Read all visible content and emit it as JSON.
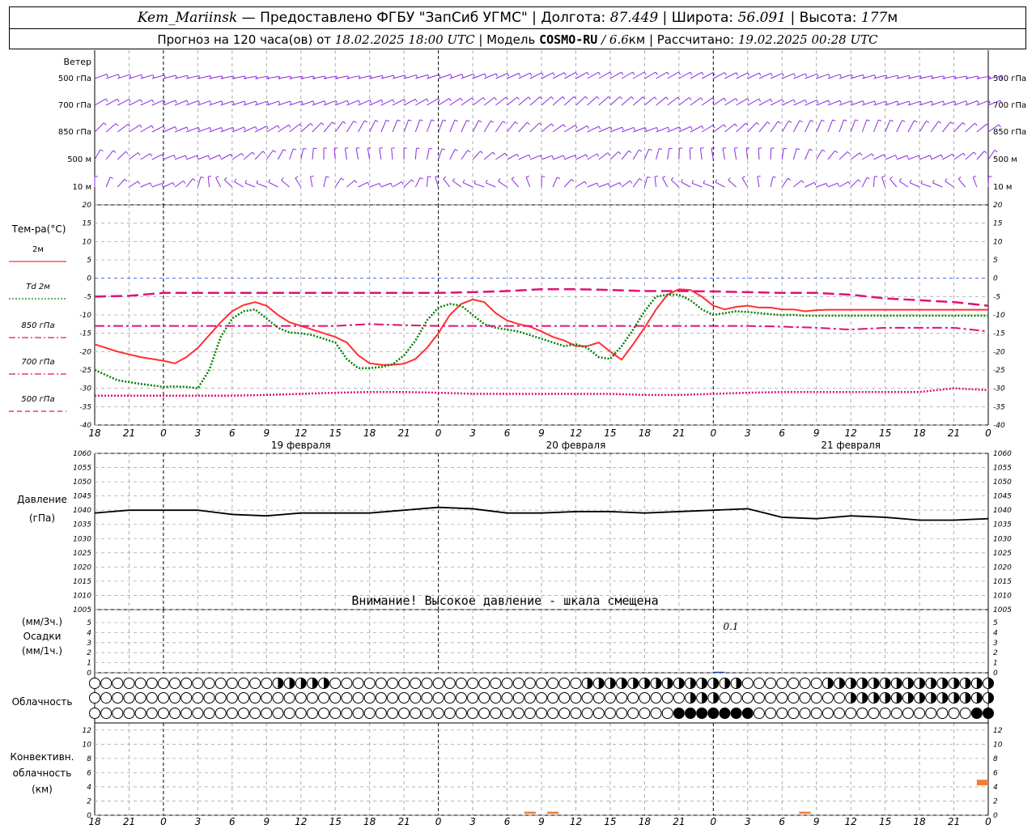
{
  "header": {
    "station": "Kem_Mariinsk",
    "dash": " — ",
    "provider": "Предоставлено ФГБУ \"ЗапСиб УГМС\"",
    "sep": " | ",
    "lon_label": "Долгота: ",
    "lon_value": "87.449",
    "lat_label": "Широта: ",
    "lat_value": "56.091",
    "alt_label": "Высота: ",
    "alt_value": "177",
    "alt_unit": "м",
    "forecast_label": "Прогноз на 120 часа(ов) от ",
    "forecast_start": "18.02.2025 18:00 UTC",
    "model_label": "Модель ",
    "model_name": "COSMO-RU",
    "model_res": " / 6.6",
    "model_res_unit": "км",
    "calc_label": "Рассчитано: ",
    "calc_time": "19.02.2025 00:28 UTC"
  },
  "x_axis": {
    "ticks": [
      "18",
      "21",
      "0",
      "3",
      "6",
      "9",
      "12",
      "15",
      "18",
      "21",
      "0",
      "3",
      "6",
      "9",
      "12",
      "15",
      "18",
      "21",
      "0",
      "3",
      "6",
      "9",
      "12",
      "15",
      "18",
      "21",
      "0"
    ],
    "days": [
      "19 февраля",
      "20 февраля",
      "21 февраля"
    ]
  },
  "wind": {
    "title": "Ветер",
    "levels": [
      "500 гПа",
      "700 гПа",
      "850 гПа",
      "500 м",
      "10  м"
    ],
    "color": "#8a2be2"
  },
  "temperature": {
    "title": "Тем-ра(°C)",
    "legend": [
      {
        "label": "2м",
        "color": "#ff3030",
        "style": "solid"
      },
      {
        "label": "Td  2м",
        "color": "#008000",
        "style": "dotted"
      },
      {
        "label": "850 гПа",
        "color": "#e0107a",
        "style": "dashdot"
      },
      {
        "label": "700 гПа",
        "color": "#e0107a",
        "style": "dashdot"
      },
      {
        "label": "500 гПа",
        "color": "#e0107a",
        "style": "dashed"
      }
    ],
    "ticks": [
      "20",
      "15",
      "10",
      "5",
      "0",
      "-5",
      "-10",
      "-15",
      "-20",
      "-25",
      "-30",
      "-35",
      "-40"
    ]
  },
  "pressure": {
    "title": "Давление",
    "unit": "(гПа)",
    "ticks": [
      "1060",
      "1055",
      "1050",
      "1045",
      "1040",
      "1035",
      "1030",
      "1025",
      "1020",
      "1015",
      "1010",
      "1005"
    ],
    "warning": "Внимание! Высокое давление - шкала смещена"
  },
  "precip": {
    "unit3": "(мм/3ч.)",
    "title": "Осадки",
    "unit1": "(мм/1ч.)",
    "ticks": [
      "5",
      "4",
      "3",
      "2",
      "1",
      "0"
    ],
    "annotation": "0.1"
  },
  "cloud": {
    "title": "Облачность"
  },
  "convective": {
    "title1": "Конвективн.",
    "title2": "облачность",
    "unit": "(км)",
    "ticks": [
      "12",
      "10",
      "8",
      "6",
      "4",
      "2",
      "0"
    ],
    "color": "#f08030"
  },
  "chart_data": [
    {
      "type": "line",
      "x_hours": [
        0,
        3,
        6,
        9,
        12,
        15,
        18,
        21,
        24,
        27,
        30,
        33,
        36,
        39,
        42,
        45,
        48,
        51,
        54,
        57,
        60,
        63,
        66,
        69,
        72,
        75,
        78
      ],
      "ylim": [
        -40,
        20
      ],
      "series": [
        {
          "name": "2м",
          "x": [
            0,
            2,
            4,
            6,
            7,
            8,
            9,
            10,
            11,
            12,
            13,
            14,
            15,
            16,
            17,
            18,
            19,
            20,
            21,
            22,
            23,
            24,
            25,
            26,
            27,
            28,
            29,
            30,
            31,
            32,
            33,
            34,
            35,
            36,
            37,
            38,
            39,
            40,
            41,
            42,
            43,
            44,
            45,
            46,
            47,
            48,
            49,
            50,
            51,
            52,
            53,
            54,
            55,
            56,
            57,
            58,
            59,
            60,
            61,
            62,
            63,
            64,
            65,
            66,
            67,
            68,
            69,
            70,
            71,
            72,
            73,
            74,
            75,
            76,
            77,
            78
          ],
          "y": [
            -18,
            -20,
            -21.5,
            -22.5,
            -23.2,
            -21.5,
            -19,
            -15.5,
            -12,
            -9,
            -7.3,
            -6.5,
            -7.5,
            -10,
            -12,
            -13,
            -14,
            -15,
            -16,
            -17.5,
            -21,
            -23.2,
            -23.6,
            -23.6,
            -23.3,
            -22,
            -19,
            -15,
            -10,
            -7,
            -5.8,
            -6.5,
            -9.5,
            -11.5,
            -12.5,
            -13.2,
            -14.5,
            -16,
            -17,
            -18.5,
            -18.5,
            -17.5,
            -20,
            -22.2,
            -18,
            -13.5,
            -8.5,
            -4.5,
            -3,
            -3.2,
            -5,
            -7.5,
            -8.5,
            -7.8,
            -7.5,
            -8,
            -8,
            -8.5,
            -8.5,
            -9,
            -8.7,
            -8.6,
            -8.6,
            -8.6,
            -8.6,
            -8.6,
            -8.6,
            -8.6,
            -8.6,
            -8.6,
            -8.6,
            -8.6,
            -8.6,
            -8.6,
            -8.6,
            -8.6
          ]
        },
        {
          "name": "Td  2м",
          "x": [
            0,
            2,
            4,
            6,
            7,
            8,
            9,
            10,
            11,
            12,
            13,
            14,
            15,
            16,
            17,
            18,
            19,
            20,
            21,
            22,
            23,
            24,
            25,
            26,
            27,
            28,
            29,
            30,
            31,
            32,
            33,
            34,
            35,
            36,
            37,
            38,
            39,
            40,
            41,
            42,
            43,
            44,
            45,
            46,
            47,
            48,
            49,
            50,
            51,
            52,
            53,
            54,
            55,
            56,
            57,
            58,
            59,
            60,
            61,
            62,
            63,
            64,
            65,
            66,
            67,
            68,
            69,
            70,
            71,
            72,
            73,
            74,
            75,
            76,
            77,
            78
          ],
          "y": [
            -25,
            -27.8,
            -28.8,
            -29.6,
            -29.5,
            -29.6,
            -30,
            -25,
            -16,
            -11,
            -9,
            -8.5,
            -11,
            -13.5,
            -14.8,
            -15,
            -15.5,
            -16.5,
            -17.5,
            -22,
            -24.5,
            -24.5,
            -24.2,
            -23.5,
            -21,
            -17,
            -11.5,
            -8,
            -7,
            -7.5,
            -10,
            -12.5,
            -13.5,
            -14,
            -14.5,
            -15.5,
            -16.5,
            -17.5,
            -18.5,
            -18,
            -19,
            -21.5,
            -22,
            -18.5,
            -14,
            -9,
            -5,
            -4.5,
            -4.5,
            -6,
            -8.5,
            -10,
            -9.5,
            -9,
            -9.2,
            -9.5,
            -9.8,
            -10,
            -10,
            -10.2,
            -10.2,
            -10.2,
            -10.2,
            -10.2,
            -10.2,
            -10.2,
            -10.2,
            -10.2,
            -10.2,
            -10.2,
            -10.2,
            -10.2,
            -10.2,
            -10.2,
            -10.2,
            -10.2
          ]
        },
        {
          "name": "850 гПа",
          "x": [
            0,
            3,
            6,
            9,
            12,
            15,
            18,
            21,
            24,
            27,
            30,
            33,
            36,
            39,
            42,
            45,
            48,
            51,
            54,
            57,
            60,
            63,
            66,
            69,
            72,
            75,
            78
          ],
          "y": [
            -5,
            -4.8,
            -4,
            -4,
            -4,
            -4,
            -4,
            -4,
            -4,
            -4,
            -4,
            -3.8,
            -3.5,
            -3,
            -3,
            -3.2,
            -3.5,
            -3.5,
            -3.6,
            -3.8,
            -4,
            -4,
            -4.5,
            -5.5,
            -6,
            -6.5,
            -7.5
          ]
        },
        {
          "name": "700 гПа",
          "x": [
            0,
            3,
            6,
            9,
            12,
            15,
            18,
            21,
            24,
            27,
            30,
            33,
            36,
            39,
            42,
            45,
            48,
            51,
            54,
            57,
            60,
            63,
            66,
            69,
            72,
            75,
            78
          ],
          "y": [
            -13,
            -13,
            -13,
            -13,
            -13,
            -13,
            -13,
            -13,
            -12.5,
            -12.8,
            -13,
            -13,
            -13,
            -13,
            -13,
            -13,
            -13,
            -13,
            -13,
            -13,
            -13.2,
            -13.5,
            -14,
            -13.5,
            -13.5,
            -13.5,
            -14.5
          ]
        },
        {
          "name": "500 гПа",
          "x": [
            0,
            3,
            6,
            9,
            12,
            15,
            18,
            21,
            24,
            27,
            30,
            33,
            36,
            39,
            42,
            45,
            48,
            51,
            54,
            57,
            60,
            63,
            66,
            69,
            72,
            75,
            78
          ],
          "y": [
            -32,
            -32,
            -32,
            -32,
            -32,
            -31.8,
            -31.5,
            -31.2,
            -31,
            -31,
            -31.2,
            -31.5,
            -31.5,
            -31.5,
            -31.5,
            -31.5,
            -31.8,
            -31.8,
            -31.5,
            -31.2,
            -31,
            -31,
            -31,
            -31,
            -31,
            -30,
            -30.5
          ]
        }
      ]
    },
    {
      "type": "line",
      "series": [
        {
          "name": "Давление",
          "x": [
            0,
            3,
            6,
            9,
            12,
            15,
            18,
            21,
            24,
            27,
            30,
            33,
            36,
            39,
            42,
            45,
            48,
            51,
            54,
            57,
            60,
            63,
            66,
            69,
            72,
            75,
            78
          ],
          "y": [
            1039,
            1040,
            1040,
            1040,
            1038.5,
            1038,
            1039,
            1039,
            1039,
            1040,
            1041,
            1040.5,
            1039,
            1039,
            1039.5,
            1039.5,
            1039,
            1039.5,
            1040,
            1040.5,
            1037.5,
            1037,
            1038,
            1037.5,
            1036.5,
            1036.5,
            1037
          ]
        }
      ],
      "ylim": [
        1005,
        1060
      ]
    },
    {
      "type": "bar",
      "name": "Осадки",
      "x": [
        54
      ],
      "values": [
        0.1
      ],
      "ylim": [
        0,
        5
      ]
    },
    {
      "type": "bar",
      "name": "Конвективная облачность",
      "bars": [
        {
          "x_start": 37.5,
          "x_end": 38.5,
          "base": 0.2,
          "top": 0.5
        },
        {
          "x_start": 39.5,
          "x_end": 40.5,
          "base": 0.2,
          "top": 0.5
        },
        {
          "x_start": 61.5,
          "x_end": 62.5,
          "base": 0.2,
          "top": 0.5
        },
        {
          "x_start": 77,
          "x_end": 78,
          "base": 4.2,
          "top": 5
        }
      ],
      "ylim": [
        0,
        13
      ]
    }
  ]
}
